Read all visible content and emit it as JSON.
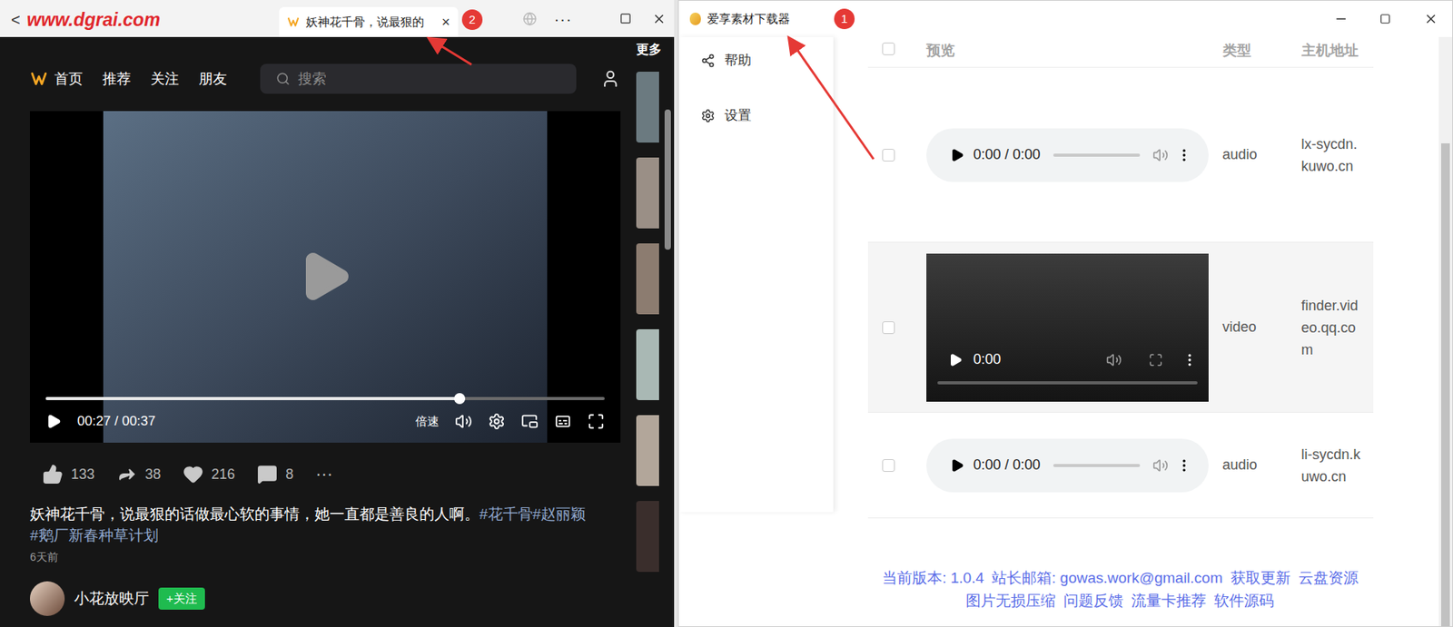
{
  "watermark": "www.dgrai.com",
  "browser": {
    "back": "<",
    "tab": {
      "label": "妖神花千骨，说最狠的",
      "close": "×",
      "selected": true
    },
    "badge": "2",
    "menu": "···",
    "nav": {
      "items": [
        {
          "label": "首页"
        },
        {
          "label": "推荐"
        },
        {
          "label": "关注"
        },
        {
          "label": "朋友"
        }
      ],
      "search_placeholder": "搜索"
    },
    "video": {
      "time": "00:27 / 00:37",
      "level": 0.74,
      "speed": "倍速",
      "playing": false
    },
    "more": {
      "label": "更多"
    },
    "actions": [
      {
        "kind": "like",
        "count": "133"
      },
      {
        "kind": "share",
        "count": "38"
      },
      {
        "kind": "favorite",
        "count": "216"
      },
      {
        "kind": "comment",
        "count": "8"
      }
    ],
    "more_actions": "···",
    "description": {
      "text": "妖神花千骨，说最狠的话做最心软的事情，她一直都是善良的人啊。",
      "tags": [
        "#花千骨",
        "#赵丽颖",
        "#鹅厂新春种草计划"
      ]
    },
    "age": "6天前",
    "author": {
      "name": "小花放映厅",
      "follow": "+关注"
    }
  },
  "downloader": {
    "title": "爱享素材下载器",
    "badge": "1",
    "sidebar": {
      "items": [
        {
          "label": "帮助",
          "kind": "share"
        },
        {
          "label": "设置",
          "kind": "settings"
        }
      ]
    },
    "table": {
      "columns": [
        "预览",
        "类型",
        "主机地址"
      ],
      "header_checked": false,
      "rows": [
        {
          "kind": "audio",
          "time": "0:00 / 0:00",
          "type": "audio",
          "host": "lx-sycdn.kuwo.cn",
          "checked": false
        },
        {
          "kind": "video",
          "time": "0:00",
          "type": "video",
          "host": "finder.video.qq.com",
          "checked": false
        },
        {
          "kind": "audio",
          "time": "0:00 / 0:00",
          "type": "audio",
          "host": "li-sycdn.kuwo.cn",
          "checked": false
        }
      ]
    },
    "footer": {
      "lines": [
        [
          "当前版本: 1.0.4",
          "站长邮箱: gowas.work@gmail.com",
          "获取更新",
          "云盘资源"
        ],
        [
          "图片无损压缩",
          "问题反馈",
          "流量卡推荐",
          "软件源码"
        ]
      ]
    }
  }
}
